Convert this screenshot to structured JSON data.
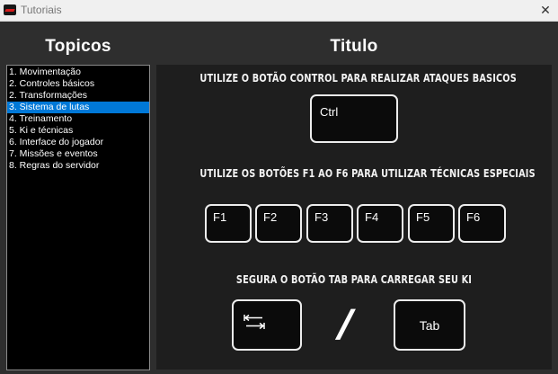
{
  "window": {
    "title": "Tutoriais",
    "close_glyph": "✕"
  },
  "sidebar": {
    "heading": "Topicos",
    "items": [
      {
        "label": "1. Movimentação"
      },
      {
        "label": "2. Controles básicos"
      },
      {
        "label": "2. Transformações"
      },
      {
        "label": "3. Sistema de lutas",
        "selected": true
      },
      {
        "label": "4. Treinamento"
      },
      {
        "label": "5. Ki e técnicas"
      },
      {
        "label": "6. Interface do jogador"
      },
      {
        "label": "7. Missões e eventos"
      },
      {
        "label": "8. Regras do servidor"
      }
    ],
    "selected_color": "#0078d7"
  },
  "content": {
    "heading": "Titulo",
    "instruction_1": "UTILIZE O BOTÃO CONTROL PARA REALIZAR ATAQUES BASICOS",
    "instruction_2": "UTILIZE OS BOTÕES F1 AO F6 PARA UTILIZAR TÉCNICAS ESPECIAIS",
    "instruction_3": "SEGURA O BOTÃO TAB PARA CARREGAR SEU KI",
    "ctrl_key": "Ctrl",
    "function_keys": [
      "F1",
      "F2",
      "F3",
      "F4",
      "F5",
      "F6"
    ],
    "separator": "/",
    "tab_key": "Tab",
    "tab_icon": "tab-arrows-icon"
  }
}
